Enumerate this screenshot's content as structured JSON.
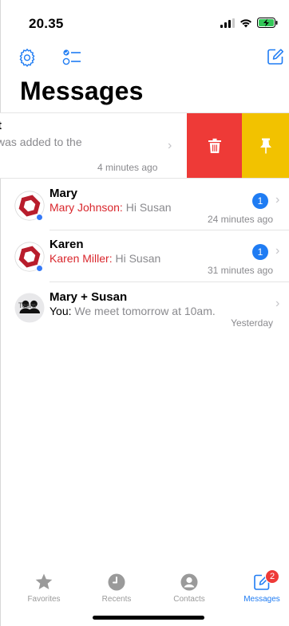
{
  "status_bar": {
    "time": "20.35",
    "icons": [
      "signal-icon",
      "wifi-icon",
      "battery-charging-icon"
    ]
  },
  "toolbar": {
    "left_icons": [
      "gear-icon",
      "checklist-icon"
    ],
    "right_icons": [
      "compose-icon"
    ]
  },
  "page_title": "Messages",
  "swiped_row": {
    "name": "t",
    "preview": "was added to the",
    "time": "4 minutes ago",
    "actions": [
      {
        "name": "delete",
        "icon": "trash-icon",
        "color": "#ee3a37"
      },
      {
        "name": "pin",
        "icon": "pin-icon",
        "color": "#f2c200"
      }
    ]
  },
  "conversations": [
    {
      "name": "Mary",
      "sender": "Mary Johnson:",
      "message": "Hi Susan",
      "time": "24 minutes ago",
      "unread": "1",
      "avatar": "red-hexagon-avatar"
    },
    {
      "name": "Karen",
      "sender": "Karen Miller:",
      "message": "Hi Susan",
      "time": "31 minutes ago",
      "unread": "1",
      "avatar": "red-hexagon-avatar"
    },
    {
      "name": "Mary + Susan",
      "sender": "You:",
      "message": "We meet tomorrow at 10am.",
      "time": "Yesterday",
      "avatar": "team-icon",
      "avatar_label": "Team"
    }
  ],
  "tab_bar": {
    "tabs": [
      {
        "label": "Favorites",
        "icon": "star-icon",
        "active": false
      },
      {
        "label": "Recents",
        "icon": "clock-icon",
        "active": false
      },
      {
        "label": "Contacts",
        "icon": "person-icon",
        "active": false
      },
      {
        "label": "Messages",
        "icon": "compose-icon",
        "active": true,
        "badge": "2"
      }
    ]
  },
  "colors": {
    "accent": "#1f7cf3",
    "sender": "#d9262c",
    "delete": "#ee3a37",
    "pin": "#f2c200",
    "badge": "#1f7cf3",
    "tab_badge": "#ee3a37"
  }
}
